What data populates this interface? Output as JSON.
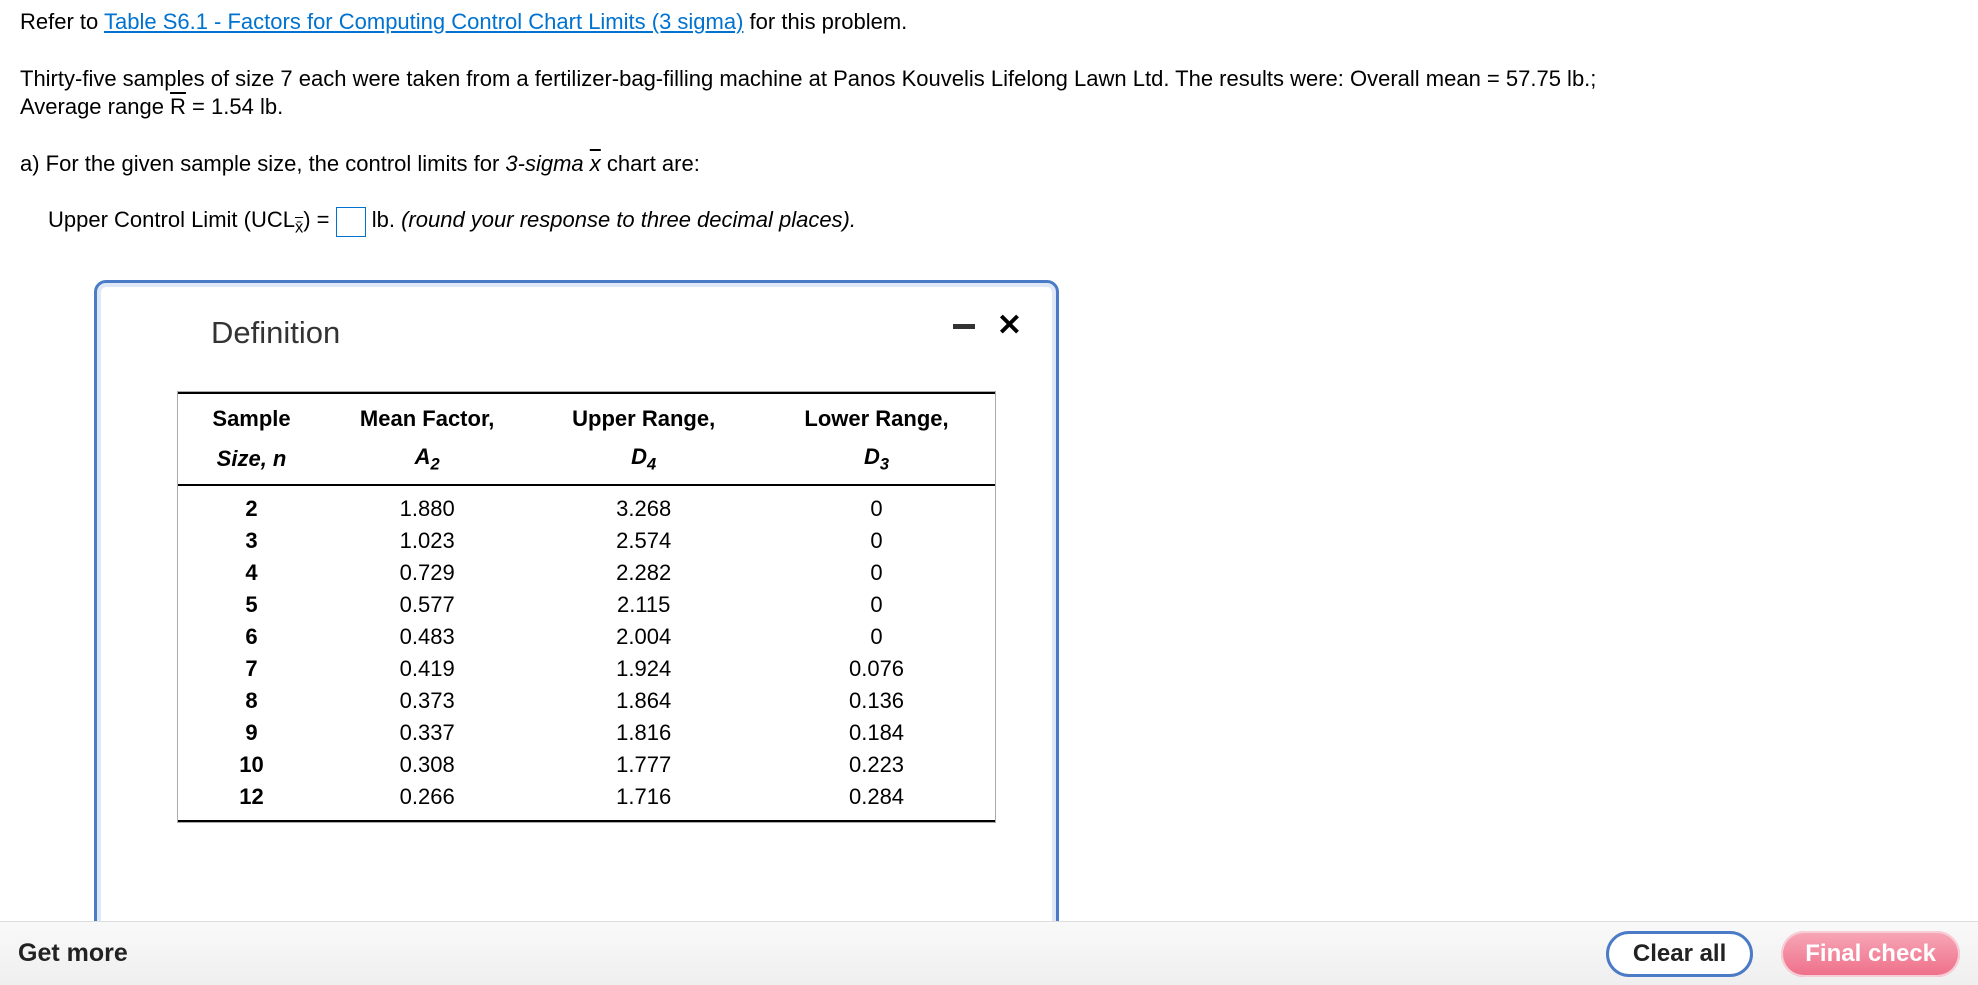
{
  "problem": {
    "refer_prefix": "Refer to ",
    "refer_link": "Table S6.1 - Factors for Computing Control Chart Limits (3 sigma)",
    "refer_suffix": " for this problem.",
    "p2a": "Thirty-five samples of size 7 each were taken from a fertilizer-bag-filling machine at Panos Kouvelis Lifelong Lawn Ltd. The results were: Overall mean = 57.75 lb.;",
    "p2b_prefix": "Average range ",
    "p2b_rbar": "R",
    "p2b_suffix": " = 1.54 lb.",
    "qa_prefix": "a) For the given sample size, the control limits for ",
    "qa_3sigma": "3-sigma ",
    "qa_xbar": "x",
    "qa_suffix": " chart are:",
    "ucl_prefix": "Upper Control Limit (UCL",
    "ucl_sub": "x̄",
    "ucl_mid": ") = ",
    "ucl_unit": " lb. ",
    "ucl_hint": "(round your response to three decimal places)."
  },
  "modal": {
    "title": "Definition",
    "headers": {
      "c1a": "Sample",
      "c1b": "Size, n",
      "c2a": "Mean Factor,",
      "c2b_pre": "A",
      "c2b_sub": "2",
      "c3a": "Upper Range,",
      "c3b_pre": "D",
      "c3b_sub": "4",
      "c4a": "Lower Range,",
      "c4b_pre": "D",
      "c4b_sub": "3"
    },
    "rows": [
      {
        "n": "2",
        "a2": "1.880",
        "d4": "3.268",
        "d3": "0"
      },
      {
        "n": "3",
        "a2": "1.023",
        "d4": "2.574",
        "d3": "0"
      },
      {
        "n": "4",
        "a2": "0.729",
        "d4": "2.282",
        "d3": "0"
      },
      {
        "n": "5",
        "a2": "0.577",
        "d4": "2.115",
        "d3": "0"
      },
      {
        "n": "6",
        "a2": "0.483",
        "d4": "2.004",
        "d3": "0"
      },
      {
        "n": "7",
        "a2": "0.419",
        "d4": "1.924",
        "d3": "0.076"
      },
      {
        "n": "8",
        "a2": "0.373",
        "d4": "1.864",
        "d3": "0.136"
      },
      {
        "n": "9",
        "a2": "0.337",
        "d4": "1.816",
        "d3": "0.184"
      },
      {
        "n": "10",
        "a2": "0.308",
        "d4": "1.777",
        "d3": "0.223"
      },
      {
        "n": "12",
        "a2": "0.266",
        "d4": "1.716",
        "d3": "0.284"
      }
    ]
  },
  "footer": {
    "get_more": "Get more",
    "clear_all": "Clear all",
    "final_check": "Final check"
  }
}
